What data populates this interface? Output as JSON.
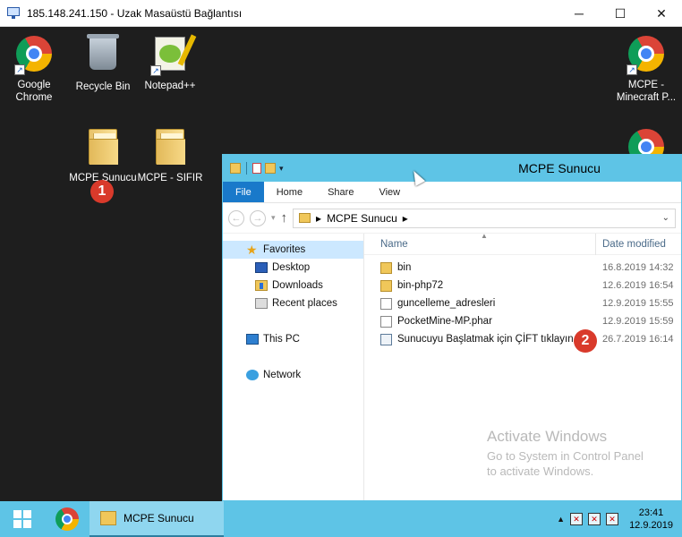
{
  "rdp": {
    "title": "185.148.241.150 - Uzak Masaüstü Bağlantısı",
    "minimize": "─",
    "maximize": "☐",
    "close": "✕"
  },
  "desktop": {
    "icons": [
      {
        "label": "Google\nChrome",
        "icon": "chrome-icon"
      },
      {
        "label": "Recycle Bin",
        "icon": "recycle-bin-icon"
      },
      {
        "label": "Notepad++",
        "icon": "notepadpp-icon"
      },
      {
        "label": "MCPE Sunucu",
        "icon": "folder-icon"
      },
      {
        "label": "MCPE - SIFIR",
        "icon": "folder-icon"
      },
      {
        "label": "MCPE -\nMinecraft P...",
        "icon": "chrome-icon"
      }
    ],
    "badges": [
      "1",
      "2"
    ],
    "activate": {
      "heading": "Activate Windows",
      "line1": "Go to System in Control Panel",
      "line2": "to activate Windows."
    }
  },
  "explorer": {
    "title": "MCPE Sunucu",
    "ribbon_tabs": [
      "File",
      "Home",
      "Share",
      "View"
    ],
    "address_path": "MCPE Sunucu",
    "address_sep": "▸",
    "nav": {
      "favorites": "Favorites",
      "desktop": "Desktop",
      "downloads": "Downloads",
      "recent": "Recent places",
      "this_pc": "This PC",
      "network": "Network"
    },
    "columns": {
      "name": "Name",
      "date": "Date modified"
    },
    "files": [
      {
        "name": "bin",
        "date": "16.8.2019 14:32",
        "type": "folder"
      },
      {
        "name": "bin-php72",
        "date": "12.6.2019 16:54",
        "type": "folder"
      },
      {
        "name": "guncelleme_adresleri",
        "date": "12.9.2019 15:55",
        "type": "file"
      },
      {
        "name": "PocketMine-MP.phar",
        "date": "12.9.2019 15:59",
        "type": "file"
      },
      {
        "name": "Sunucuyu Başlatmak için ÇİFT tıklayın",
        "date": "26.7.2019 16:14",
        "type": "batch"
      }
    ]
  },
  "taskbar": {
    "app_label": "MCPE Sunucu",
    "time": "23:41",
    "date": "12.9.2019"
  }
}
